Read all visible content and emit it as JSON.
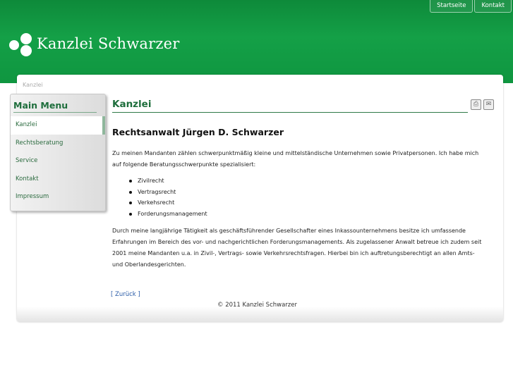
{
  "header": {
    "site_title": "Kanzlei Schwarzer",
    "top_nav": [
      "Startseite",
      "Kontakt"
    ],
    "brand_color": "#14a047"
  },
  "breadcrumb": "Kanzlei",
  "sidebar": {
    "title": "Main Menu",
    "items": [
      {
        "label": "Kanzlei",
        "active": true
      },
      {
        "label": "Rechtsberatung"
      },
      {
        "label": "Service"
      },
      {
        "label": "Kontakt"
      },
      {
        "label": "Impressum"
      }
    ]
  },
  "main": {
    "page_title": "Kanzlei",
    "icons": [
      "print-icon",
      "email-icon"
    ],
    "headline": "Rechtsanwalt Jürgen D. Schwarzer",
    "intro": "Zu meinen Mandanten zählen schwerpunktmäßig kleine und mittelständische Unternehmen sowie Privatpersonen. Ich habe mich auf folgende Beratungsschwerpunkte spezialisiert:",
    "bullets": [
      "Zivilrecht",
      "Vertragsrecht",
      "Verkehsrecht",
      "Forderungsmanagement"
    ],
    "body": "Durch meine langjährige Tätigkeit als geschäftsführender Gesellschafter eines Inkassounternehmens besitze ich umfassende Erfahrungen im Bereich des vor- und nachgerichtlichen Forderungsmanagements. Als zugelassener Anwalt betreue ich zudem seit 2001 meine Mandanten u.a. in Zivil-, Vertrags- sowie Verkehrsrechtsfragen. Hierbei bin ich auftretungsberechtigt an allen Amts- und Oberlandesgerichten.",
    "back_link": "[ Zurück ]"
  },
  "footer": {
    "copyright": "© 2011 Kanzlei Schwarzer"
  }
}
